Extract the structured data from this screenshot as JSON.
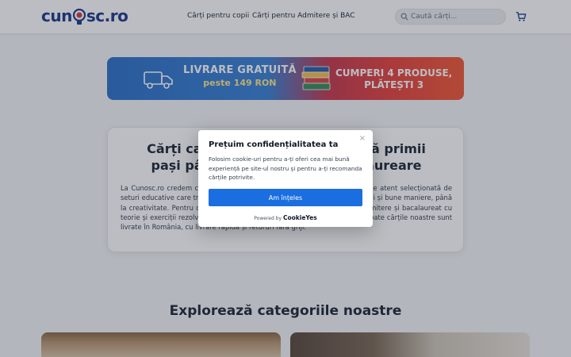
{
  "header": {
    "logo_text_left": "cun",
    "logo_text_right": "sc.ro",
    "nav": [
      "Cărți pentru copii",
      "Cărți pentru Admitere și BAC"
    ],
    "search_placeholder": "Caută cărți...",
    "icons": [
      "search-icon",
      "cart-icon"
    ]
  },
  "banner": {
    "left_line1": "LIVRARE GRATUITĂ",
    "left_line2": "peste 149 RON",
    "right_line1": "CUMPERI 4 PRODUSE,",
    "right_line2": "PLĂTEȘTI 3",
    "colors": {
      "blue": "#3b82d6",
      "red": "#e8443e",
      "yellow": "#ffe88a"
    }
  },
  "card": {
    "title": "Cărți care inspiră, educă și ajută primii pași până la admitere și bacalaureare",
    "body": "La Cunosc.ro credem că învățarea începe din copilărie. Am creat o colecție atent selecționată de seturi educative care transformă învățarea prin joc și povești — de la emoții și bune maniere, până la creativitate. Pentru cei care cresc de examene, oferim materiale de admitere și bacalaureat cu teorie și exerciții rezolvate, concepute să transforme studiul în rezultate. Toate cărțile noastre sunt livrate în România, cu livrare rapidă și retururi fără griji."
  },
  "section": {
    "title": "Explorează categoriile noastre"
  },
  "cookie": {
    "title": "Prețuim confidențialitatea ta",
    "text": "Folosim cookie-uri pentru a-ți oferi cea mai bună experiență pe site-ul nostru și pentru a-ți recomanda cărțile potrivite.",
    "accept_label": "Am înțeles",
    "powered_prefix": "Powered by",
    "powered_brand": "CookieYes",
    "close_symbol": "×",
    "accent": "#1b6ee0"
  }
}
